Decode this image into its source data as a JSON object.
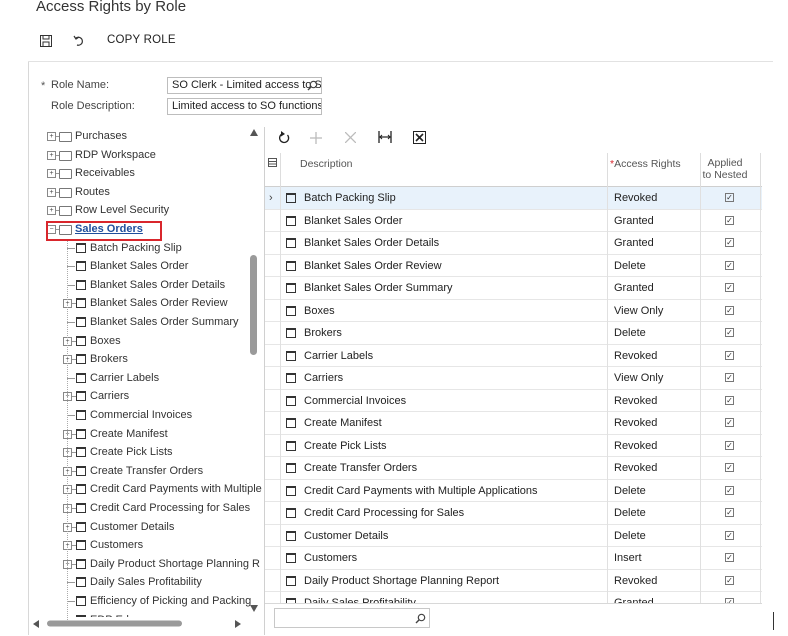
{
  "page": {
    "title": "Access Rights by Role"
  },
  "toolbar": {
    "save_icon": "save-icon",
    "undo_icon": "undo-icon",
    "copy_role_label": "COPY ROLE"
  },
  "form": {
    "role_name_required": "*",
    "role_name_label": "Role Name:",
    "role_name_value": "SO Clerk - Limited access to S",
    "role_description_label": "Role Description:",
    "role_description_value": "Limited access to SO functions"
  },
  "tree": {
    "items": [
      {
        "label": "Purchases",
        "type": "folder",
        "expander": "+"
      },
      {
        "label": "RDP Workspace",
        "type": "folder",
        "expander": "+"
      },
      {
        "label": "Receivables",
        "type": "folder",
        "expander": "+"
      },
      {
        "label": "Routes",
        "type": "folder",
        "expander": "+"
      },
      {
        "label": "Row Level Security",
        "type": "folder",
        "expander": "+"
      },
      {
        "label": "Sales Orders",
        "type": "folder",
        "expander": "−",
        "selected": true
      },
      {
        "label": "Batch Packing Slip",
        "type": "doc",
        "expander": ""
      },
      {
        "label": "Blanket Sales Order",
        "type": "doc",
        "expander": ""
      },
      {
        "label": "Blanket Sales Order Details",
        "type": "doc",
        "expander": ""
      },
      {
        "label": "Blanket Sales Order Review",
        "type": "doc",
        "expander": "+"
      },
      {
        "label": "Blanket Sales Order Summary",
        "type": "doc",
        "expander": ""
      },
      {
        "label": "Boxes",
        "type": "doc",
        "expander": "+"
      },
      {
        "label": "Brokers",
        "type": "doc",
        "expander": "+"
      },
      {
        "label": "Carrier Labels",
        "type": "doc",
        "expander": ""
      },
      {
        "label": "Carriers",
        "type": "doc",
        "expander": "+"
      },
      {
        "label": "Commercial Invoices",
        "type": "doc",
        "expander": ""
      },
      {
        "label": "Create Manifest",
        "type": "doc",
        "expander": "+"
      },
      {
        "label": "Create Pick Lists",
        "type": "doc",
        "expander": "+"
      },
      {
        "label": "Create Transfer Orders",
        "type": "doc",
        "expander": "+"
      },
      {
        "label": "Credit Card Payments with Multiple",
        "type": "doc",
        "expander": "+"
      },
      {
        "label": "Credit Card Processing for Sales",
        "type": "doc",
        "expander": "+"
      },
      {
        "label": "Customer Details",
        "type": "doc",
        "expander": "+"
      },
      {
        "label": "Customers",
        "type": "doc",
        "expander": "+"
      },
      {
        "label": "Daily Product Shortage Planning R",
        "type": "doc",
        "expander": "+"
      },
      {
        "label": "Daily Sales Profitability",
        "type": "doc",
        "expander": ""
      },
      {
        "label": "Efficiency of Picking and Packing",
        "type": "doc",
        "expander": ""
      },
      {
        "label": "EDP Ed...",
        "type": "doc",
        "expander": ""
      }
    ]
  },
  "grid_toolbar": {
    "refresh_icon": "refresh-icon",
    "add_icon": "add-icon",
    "delete_icon": "delete-icon",
    "fit_columns_icon": "fit-columns-icon",
    "export_excel_icon": "export-excel-icon"
  },
  "grid": {
    "columns": {
      "description": "Description",
      "access_rights_required": "*",
      "access_rights": "Access Rights",
      "applied_nested_1": "Applied",
      "applied_nested_2": "to Nested"
    },
    "rows": [
      {
        "description": "Batch Packing Slip",
        "access": "Revoked",
        "nested": true
      },
      {
        "description": "Blanket Sales Order",
        "access": "Granted",
        "nested": true
      },
      {
        "description": "Blanket Sales Order Details",
        "access": "Granted",
        "nested": true
      },
      {
        "description": "Blanket Sales Order Review",
        "access": "Delete",
        "nested": true
      },
      {
        "description": "Blanket Sales Order Summary",
        "access": "Granted",
        "nested": true
      },
      {
        "description": "Boxes",
        "access": "View Only",
        "nested": true
      },
      {
        "description": "Brokers",
        "access": "Delete",
        "nested": true
      },
      {
        "description": "Carrier Labels",
        "access": "Revoked",
        "nested": true
      },
      {
        "description": "Carriers",
        "access": "View Only",
        "nested": true
      },
      {
        "description": "Commercial Invoices",
        "access": "Revoked",
        "nested": true
      },
      {
        "description": "Create Manifest",
        "access": "Revoked",
        "nested": true
      },
      {
        "description": "Create Pick Lists",
        "access": "Revoked",
        "nested": true
      },
      {
        "description": "Create Transfer Orders",
        "access": "Revoked",
        "nested": true
      },
      {
        "description": "Credit Card Payments with Multiple Applications",
        "access": "Delete",
        "nested": true
      },
      {
        "description": "Credit Card Processing for Sales",
        "access": "Delete",
        "nested": true
      },
      {
        "description": "Customer Details",
        "access": "Delete",
        "nested": true
      },
      {
        "description": "Customers",
        "access": "Insert",
        "nested": true
      },
      {
        "description": "Daily Product Shortage Planning Report",
        "access": "Revoked",
        "nested": true
      },
      {
        "description": "Daily Sales Profitability",
        "access": "Granted",
        "nested": true
      }
    ]
  },
  "footer": {
    "search_icon": "search-icon"
  },
  "colors": {
    "selection_border": "#d9262c",
    "selected_row": "#e8f2fb",
    "link": "#1f4e9c"
  }
}
